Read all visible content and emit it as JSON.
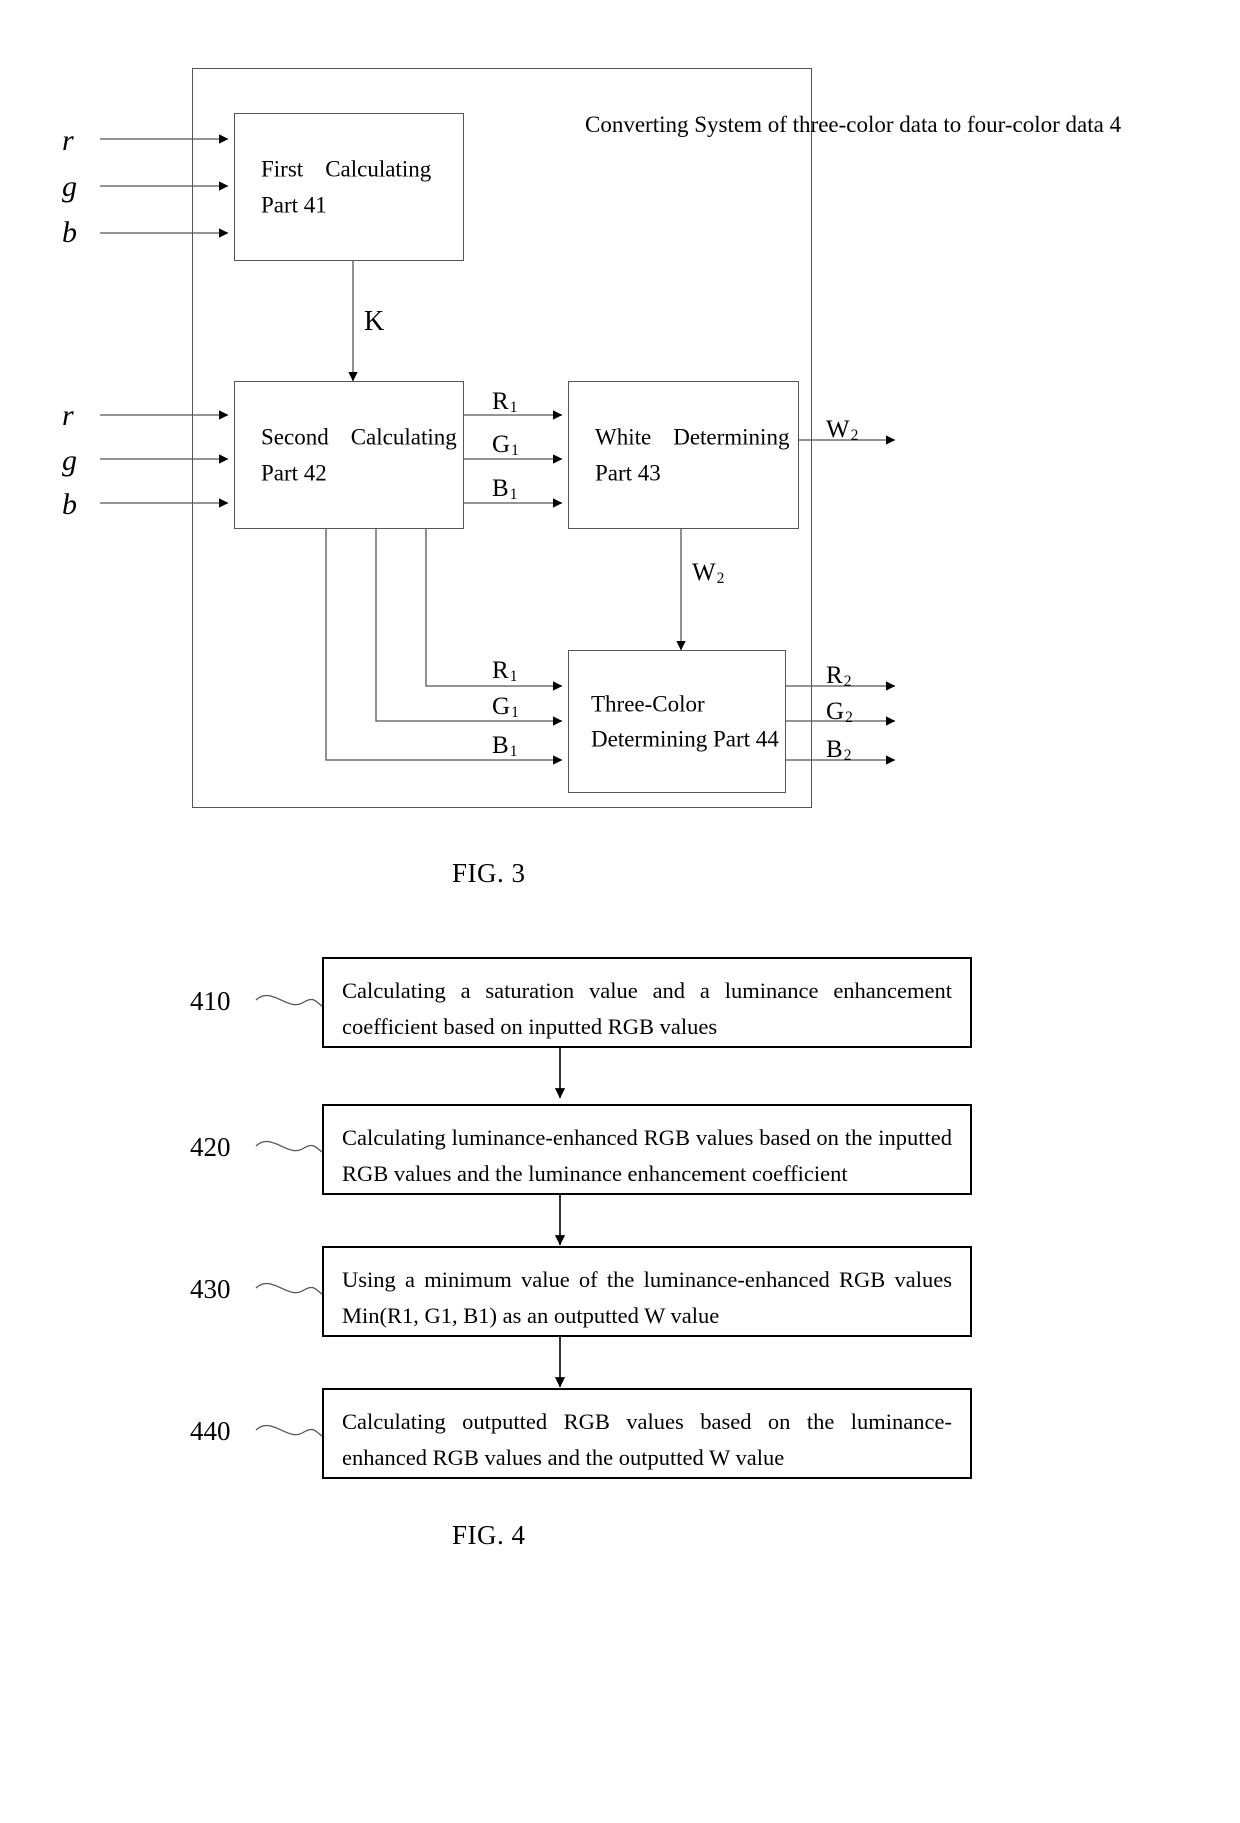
{
  "figure3": {
    "caption": "FIG. 3",
    "system_label": {
      "line1": "Converting    System",
      "line2": "of three-color data to",
      "line3": "four-color data    4"
    },
    "inputs_top": [
      {
        "label": "r"
      },
      {
        "label": "g"
      },
      {
        "label": "b"
      }
    ],
    "inputs_mid": [
      {
        "label": "r"
      },
      {
        "label": "g"
      },
      {
        "label": "b"
      }
    ],
    "blocks": [
      {
        "id": "first-calculating-part",
        "line1": "First",
        "line1b": "Calculating",
        "line2": "Part 41"
      },
      {
        "id": "second-calculating-part",
        "line1": "Second",
        "line1b": "Calculating",
        "line2": "Part 42"
      },
      {
        "id": "white-determining-part",
        "line1": "White",
        "line1b": "Determining",
        "line2": "Part 43"
      },
      {
        "id": "three-color-determining-part",
        "line1": "Three-Color",
        "line2": "Determining Part 44"
      }
    ],
    "signals": {
      "k": "K",
      "r1": "R",
      "r1_sub": "1",
      "g1": "G",
      "g1_sub": "1",
      "b1": "B",
      "b1_sub": "1",
      "w2": "W",
      "w2_sub": "2",
      "r2": "R",
      "r2_sub": "2",
      "g2": "G",
      "g2_sub": "2",
      "b2": "B",
      "b2_sub": "2"
    }
  },
  "figure4": {
    "caption": "FIG. 4",
    "steps": [
      {
        "number": "410",
        "text": "Calculating a saturation value and a luminance enhancement coefficient based on inputted RGB values"
      },
      {
        "number": "420",
        "text": "Calculating luminance-enhanced RGB values based on the inputted RGB values and the luminance enhancement coefficient"
      },
      {
        "number": "430",
        "text": "Using a minimum value of the luminance-enhanced RGB values Min(R1, G1, B1) as an outputted W value"
      },
      {
        "number": "440",
        "text": "Calculating outputted RGB values based on the luminance-enhanced RGB values and the outputted W value"
      }
    ]
  },
  "colors": {
    "line": "#555555",
    "ink": "#000000",
    "background": "#ffffff"
  }
}
